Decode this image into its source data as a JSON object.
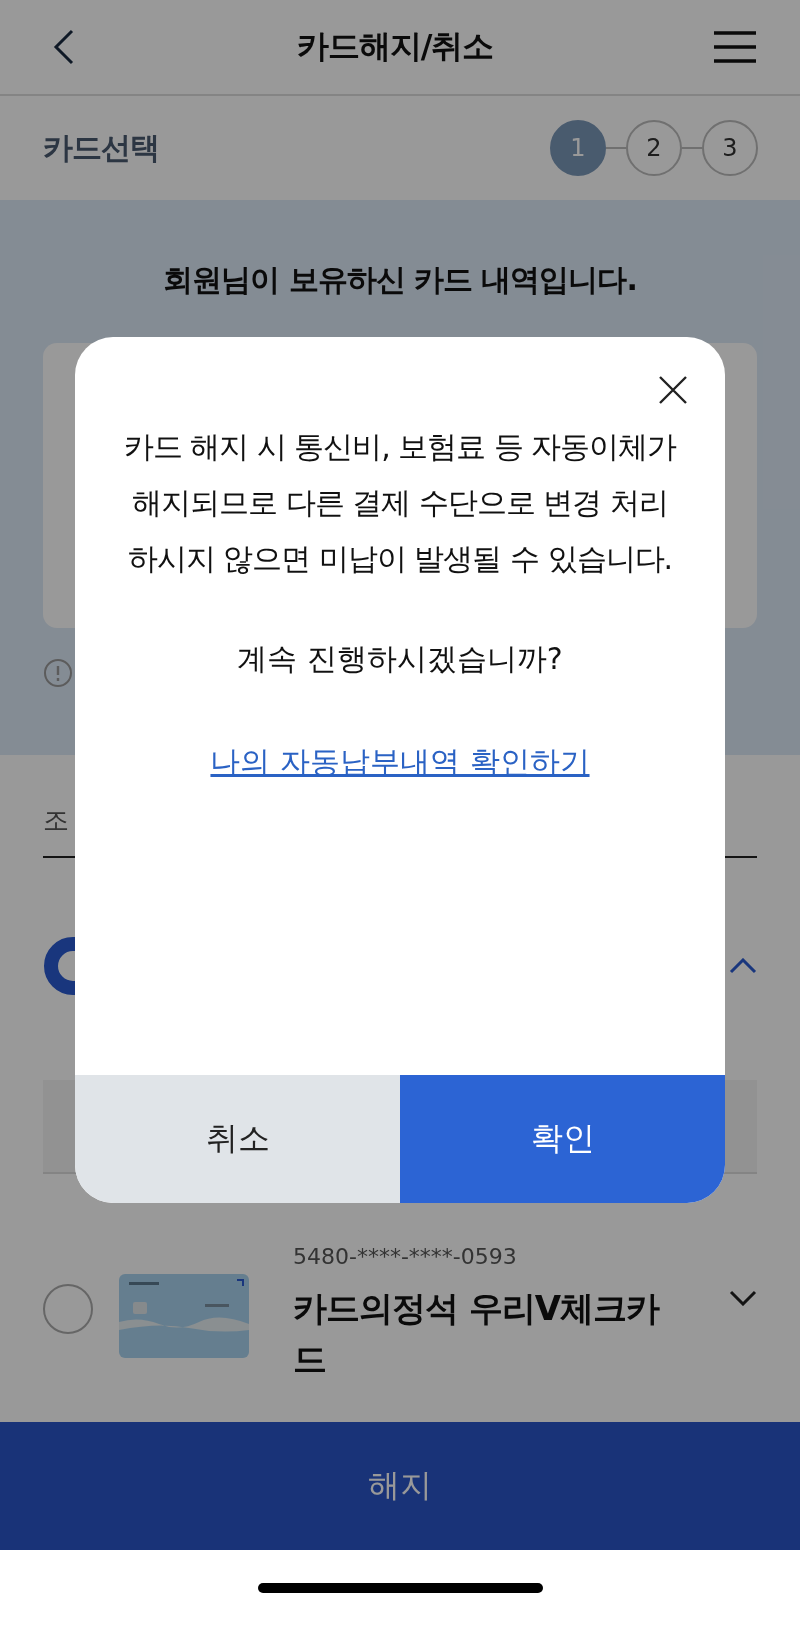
{
  "header": {
    "title": "카드해지/취소"
  },
  "steps": {
    "label": "카드선택",
    "items": [
      {
        "label": "1",
        "selected": true
      },
      {
        "label": "2",
        "selected": false
      },
      {
        "label": "3",
        "selected": false
      }
    ]
  },
  "panel": {
    "heading": "회원님이 보유하신 카드 내역입니다."
  },
  "filter": {
    "label": "조"
  },
  "card": {
    "number": "5480-****-****-0593",
    "name": "카드의정석 우리V체크카드",
    "selected": false
  },
  "bottom_button": "해지",
  "dialog": {
    "message": "카드 해지 시 통신비, 보험료 등 자동이체가 해지되므로 다른 결제 수단으로 변경 처리하시지 않으면 미납이 발생될 수 있습니다.",
    "question": "계속 진행하시겠습니까?",
    "link": "나의 자동납부내역 확인하기",
    "buttons": [
      {
        "label": "취소",
        "kind": "cancel"
      },
      {
        "label": "확인",
        "kind": "confirm"
      }
    ]
  }
}
